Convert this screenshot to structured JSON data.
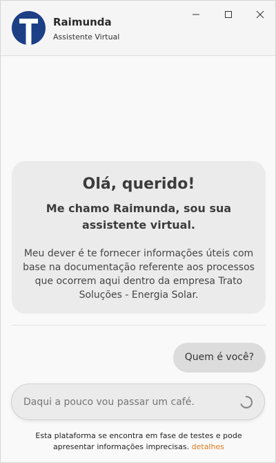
{
  "header": {
    "title": "Raimunda",
    "subtitle": "Assistente Virtual",
    "avatar_icon": "t-logo-icon",
    "avatar_color": "#1c3f86"
  },
  "window_controls": {
    "minimize_icon": "minimize-icon",
    "maximize_icon": "maximize-icon",
    "close_icon": "close-icon"
  },
  "welcome": {
    "greeting": "Olá, querido!",
    "intro": "Me chamo Raimunda, sou sua assistente virtual.",
    "description": "Meu dever é te fornecer informações úteis com base na documentação referente aos processos que ocorrem aqui dentro da empresa Trato Soluções - Energia Solar."
  },
  "messages": [
    {
      "role": "user",
      "text": "Quem é você?"
    }
  ],
  "input": {
    "placeholder": "Daqui a pouco vou passar um café.",
    "status_icon": "loading-spinner-icon"
  },
  "footer": {
    "disclaimer": "Esta plataforma se encontra em fase de testes e pode apresentar informações imprecisas.",
    "link_label": "detalhes",
    "link_color": "#e07b1a"
  }
}
